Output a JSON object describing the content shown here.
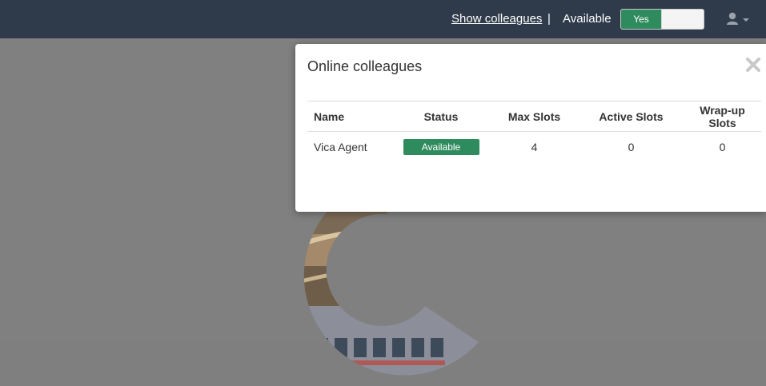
{
  "topbar": {
    "show_colleagues_link": "Show colleagues",
    "separator": "|",
    "availability_label": "Available",
    "toggle_on_label": "Yes",
    "user_icon": "user-icon",
    "caret_icon": "caret-down-icon"
  },
  "modal": {
    "title": "Online colleagues",
    "close_icon": "close-icon",
    "columns": [
      "Name",
      "Status",
      "Max Slots",
      "Active Slots",
      "Wrap-up Slots"
    ],
    "rows": [
      {
        "name": "Vica Agent",
        "status": "Available",
        "max_slots": "4",
        "active_slots": "0",
        "wrapup_slots": "0"
      }
    ]
  },
  "colors": {
    "topbar": "#2f3b4a",
    "accent_green": "#2e8b5e",
    "overlay": "#808080"
  }
}
